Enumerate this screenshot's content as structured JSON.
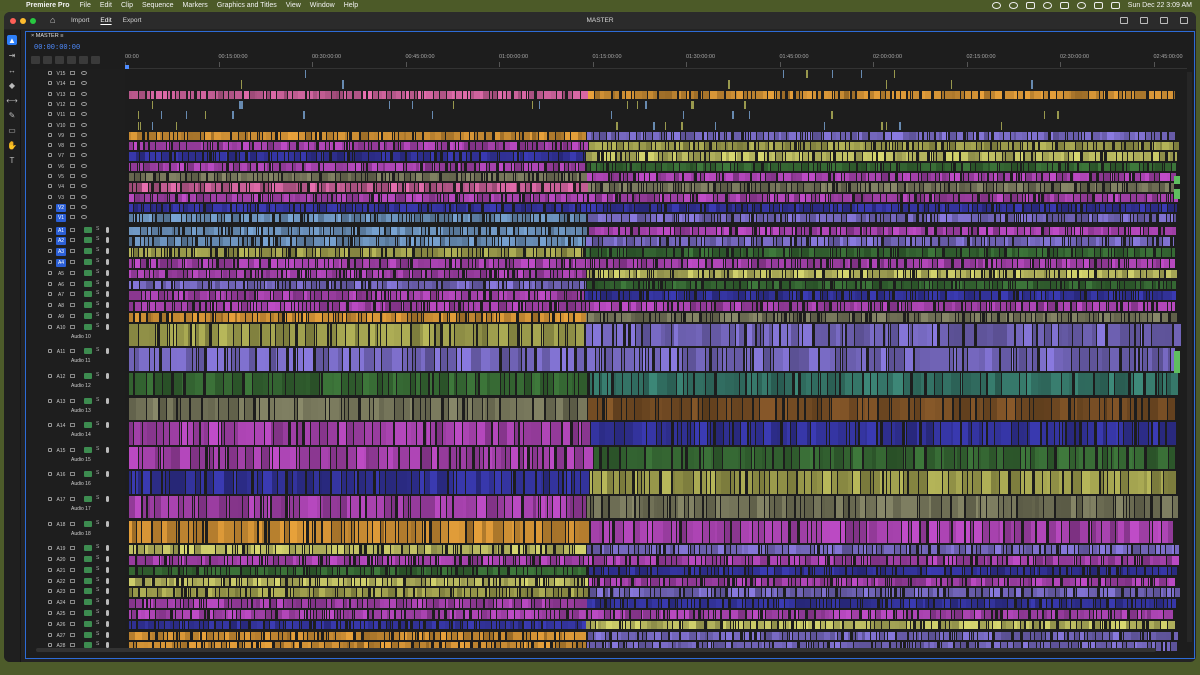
{
  "menubar": {
    "app_name": "Premiere Pro",
    "items": [
      "File",
      "Edit",
      "Clip",
      "Sequence",
      "Markers",
      "Graphics and Titles",
      "View",
      "Window",
      "Help"
    ],
    "clock": "Sun Dec 22  3:09 AM"
  },
  "titlebar": {
    "workspaces": [
      "Import",
      "Edit",
      "Export"
    ],
    "active_workspace": "Edit",
    "window_title": "MASTER"
  },
  "timeline": {
    "sequence_tab": "MASTER",
    "timecode": "00:00:00:00",
    "ruler_labels": [
      "00:00",
      "00:15:00:00",
      "00:30:00:00",
      "00:45:00:00",
      "01:00:00:00",
      "01:15:00:00",
      "01:30:00:00",
      "01:45:00:00",
      "02:00:00:00",
      "02:15:00:00",
      "02:30:00:00",
      "02:45:00:00"
    ],
    "video_tracks": [
      "V15",
      "V14",
      "V13",
      "V12",
      "V11",
      "V10",
      "V9",
      "V8",
      "V7",
      "V6",
      "V5",
      "V4",
      "V3",
      "V2",
      "V1"
    ],
    "audio_tracks_small_a": [
      "A1",
      "A2",
      "A3",
      "A4",
      "A5",
      "A6",
      "A7",
      "A8",
      "A9"
    ],
    "audio_tracks_tall": [
      {
        "id": "A10",
        "name": "Audio 10"
      },
      {
        "id": "A11",
        "name": "Audio 11"
      },
      {
        "id": "A12",
        "name": "Audio 12"
      },
      {
        "id": "A13",
        "name": "Audio 13"
      },
      {
        "id": "A14",
        "name": "Audio 14"
      },
      {
        "id": "A15",
        "name": "Audio 15"
      },
      {
        "id": "A16",
        "name": "Audio 16"
      },
      {
        "id": "A17",
        "name": "Audio 17"
      },
      {
        "id": "A18",
        "name": "Audio 18"
      }
    ],
    "audio_tracks_small_b": [
      "A19",
      "A20",
      "A21",
      "A22",
      "A23",
      "A24",
      "A25",
      "A26",
      "A27",
      "A28"
    ],
    "track_button_m": "M",
    "track_button_s": "S"
  },
  "colors": {
    "accent": "#2d7ff9",
    "pink": "#e86fb0",
    "orange": "#e9a23b",
    "violet": "#8a7ae0",
    "magenta": "#c04cc8",
    "olive": "#b8b85a",
    "green": "#3f7a3c",
    "blue": "#3b3bb5",
    "teal": "#3e8a7a",
    "skyblue": "#7aa6d6",
    "brown": "#8a5a2a",
    "yellow": "#d8d870",
    "gray": "#8a8a6a"
  }
}
